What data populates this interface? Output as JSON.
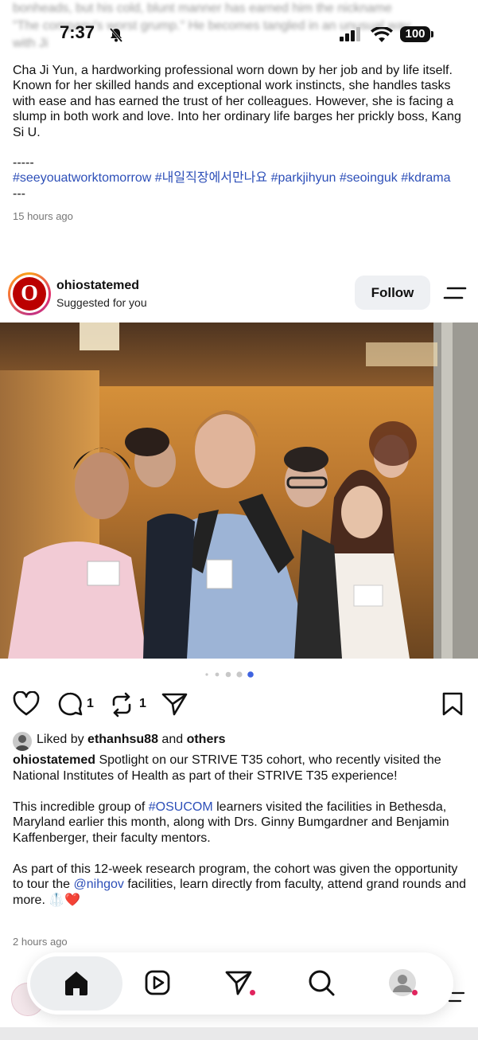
{
  "status": {
    "time": "7:37",
    "battery": "100",
    "blurred_text_line1": "bonheads, but his cold, blunt manner has earned him the nickname",
    "blurred_text_line2": "\"The company's worst grump.\" He becomes tangled in an unusual way",
    "blurred_text_line3": "with Ji"
  },
  "previous_post": {
    "caption": "Cha Ji Yun, a hardworking professional worn down by her job and by life itself. Known for her skilled hands and exceptional work instincts, she handles tasks with ease and has earned the trust of her colleagues. However, she is facing a slump in both work and love. Into her ordinary life barges her prickly boss, Kang Si U.",
    "separator_top": "-----",
    "hashtags": "#seeyouatworktomorrow #내일직장에서만나요 #parkjihyun #seoinguk #kdrama",
    "separator_bottom": "---",
    "time_ago": "15 hours ago"
  },
  "post": {
    "username": "ohiostatemed",
    "subtitle": "Suggested for you",
    "avatar_letter": "O",
    "follow_label": "Follow",
    "comment_count": "1",
    "repost_count": "1",
    "liked_prefix": "Liked by ",
    "liked_user": "ethanhsu88",
    "liked_and": " and ",
    "liked_others": "others",
    "caption_user": "ohiostatemed",
    "caption_p1": " Spotlight on our STRIVE T35 cohort, who recently visited the National Institutes of Health as part of their STRIVE T35 experience!",
    "caption_p2_before": "This incredible group of ",
    "caption_p2_tag": "#OSUCOM",
    "caption_p2_after": " learners visited the facilities in Bethesda, Maryland earlier this month, along with Drs. Ginny Bumgardner and Benjamin Kaffenberger, their faculty mentors.",
    "caption_p3_before": "As part of this 12-week research program, the cohort was given the opportunity to tour the ",
    "caption_p3_mention": "@nihgov",
    "caption_p3_after": " facilities, learn directly from faculty, attend grand rounds and more. 🥼❤️",
    "time_ago": "2 hours ago",
    "carousel": {
      "total": 5,
      "active": 5
    }
  },
  "icons": {
    "heart": "heart-icon",
    "comment": "comment-icon",
    "repost": "repost-icon",
    "share": "send-icon",
    "save": "bookmark-icon",
    "menu": "menu-icon",
    "home": "home-icon",
    "reels": "reels-icon",
    "messages": "send-icon",
    "search": "search-icon",
    "profile": "profile-icon"
  },
  "colors": {
    "link": "#2d4fb8",
    "notification": "#e0245e",
    "osu_red": "#bb0000"
  }
}
